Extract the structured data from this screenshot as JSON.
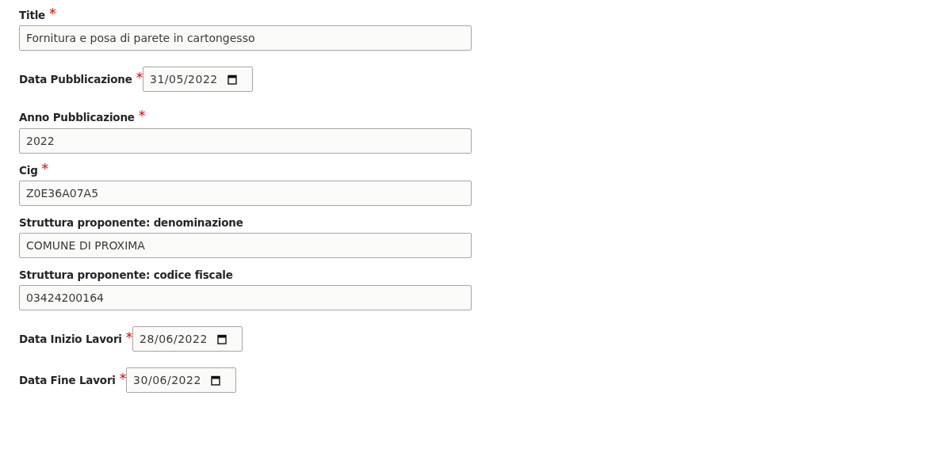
{
  "fields": [
    {
      "kind": "text",
      "label": "Title",
      "required_mark": "*",
      "value": "Fornitura e posa di parete in cartongesso"
    },
    {
      "kind": "date",
      "label": "Data Pubblicazione",
      "required_mark": "*",
      "value": "31/05/2022"
    },
    {
      "kind": "text",
      "label": "Anno Pubblicazione",
      "required_mark": "*",
      "value": "2022"
    },
    {
      "kind": "text",
      "label": "Cig",
      "required_mark": "*",
      "value": "Z0E36A07A5"
    },
    {
      "kind": "text",
      "label": "Struttura proponente: denominazione",
      "value": "COMUNE DI PROXIMA"
    },
    {
      "kind": "text",
      "label": "Struttura proponente: codice fiscale",
      "value": "03424200164"
    },
    {
      "kind": "date",
      "label": "Data Inizio Lavori",
      "required_mark": "*",
      "value": "28/06/2022"
    },
    {
      "kind": "date",
      "label": "Data Fine Lavori",
      "required_mark": "*",
      "value": "30/06/2022"
    }
  ]
}
